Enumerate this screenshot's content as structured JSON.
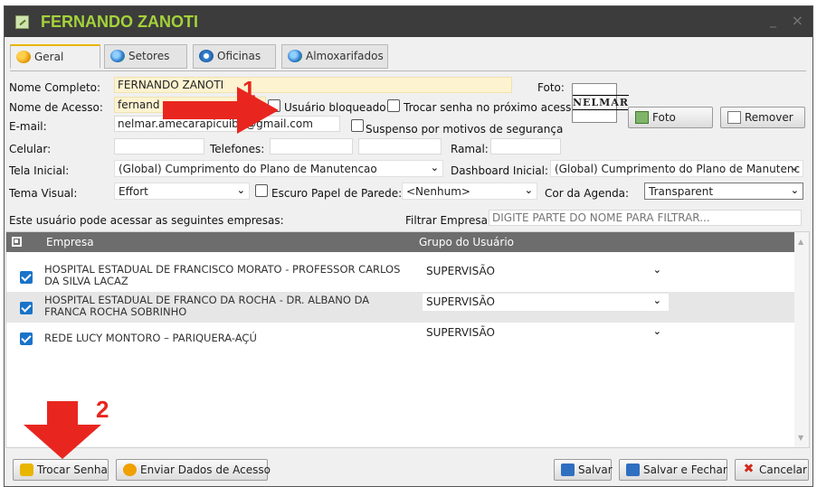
{
  "window": {
    "title": "FERNANDO ZANOTI",
    "min": "_",
    "close": "×"
  },
  "tabs": [
    {
      "label": "Geral",
      "icon": "users-icon"
    },
    {
      "label": "Setores",
      "icon": "globe-icon"
    },
    {
      "label": "Oficinas",
      "icon": "workshop-icon"
    },
    {
      "label": "Almoxarifados",
      "icon": "globe-icon"
    }
  ],
  "form": {
    "nome_completo_label": "Nome Completo:",
    "nome_completo_value": "FERNANDO ZANOTI",
    "nome_acesso_label": "Nome de Acesso:",
    "nome_acesso_value": "fernand",
    "usuario_bloqueado": "Usuário bloqueado",
    "trocar_senha": "Trocar senha no próximo acesso",
    "email_label": "E-mail:",
    "email_value": "nelmar.amecarapicuiba@gmail.com",
    "suspenso": "Suspenso por motivos de segurança",
    "celular_label": "Celular:",
    "telefones_label": "Telefones:",
    "ramal_label": "Ramal:",
    "tela_inicial_label": "Tela Inicial:",
    "tela_inicial_value": "(Global) Cumprimento do Plano de Manutencao",
    "dashboard_label": "Dashboard Inicial:",
    "dashboard_value": "(Global) Cumprimento do Plano de Manutenc",
    "tema_label": "Tema Visual:",
    "tema_value": "Effort",
    "escuro": "Escuro",
    "papel_label": "Papel de Parede:",
    "papel_value": "<Nenhum>",
    "cor_label": "Cor da Agenda:",
    "cor_value": "Transparent",
    "foto_label": "Foto:",
    "foto_logo": "NELMAR",
    "foto_button": "Foto",
    "remover_button": "Remover"
  },
  "empresas": {
    "intro": "Este usuário pode acessar as seguintes empresas:",
    "filter_label": "Filtrar Empresa:",
    "filter_placeholder": "DIGITE PARTE DO NOME PARA FILTRAR...",
    "col_empresa": "Empresa",
    "col_grupo": "Grupo do Usuário",
    "rows": [
      {
        "name": "HOSPITAL ESTADUAL DE FRANCISCO MORATO - PROFESSOR CARLOS DA SILVA LACAZ",
        "grupo": "SUPERVISÃO",
        "checked": true
      },
      {
        "name": "HOSPITAL ESTADUAL DE FRANCO DA ROCHA - DR. ALBANO DA FRANCA ROCHA SOBRINHO",
        "grupo": "SUPERVISÃO",
        "checked": true
      },
      {
        "name": "REDE LUCY MONTORO – PARIQUERA-AÇÚ",
        "grupo": "SUPERVISÃO",
        "checked": true
      }
    ]
  },
  "footer": {
    "trocar_senha": "Trocar Senha",
    "enviar_dados": "Enviar Dados de Acesso",
    "salvar": "Salvar",
    "salvar_fechar": "Salvar e Fechar",
    "cancelar": "Cancelar"
  },
  "annotations": {
    "n1": "1",
    "n2": "2",
    "color": "#e8261f"
  }
}
